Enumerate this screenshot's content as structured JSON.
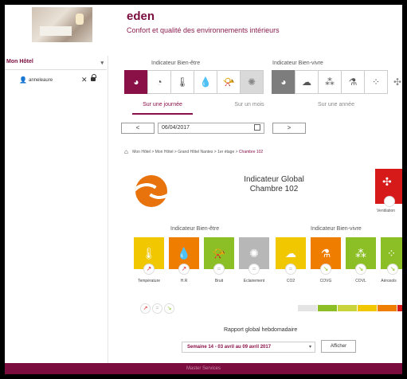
{
  "header": {
    "brand": "eden",
    "tagline": "Confort et qualité des environnements intérieurs"
  },
  "sidebar": {
    "hotel_select": "Mon Hôtel",
    "user": "anneleaure"
  },
  "indicators": {
    "wellbeing_title": "Indicateur Bien-être",
    "livability_title": "Indicateur Bien-vivre"
  },
  "tabs": [
    "Sur une journée",
    "Sur un mois",
    "Sur une année"
  ],
  "date_nav": {
    "prev": "<",
    "date": "06/04/2017",
    "next": ">"
  },
  "breadcrumb": {
    "path": "Mon Hôtel > Mon Hôtel > Grand Hôtel Nantes > 1er étage > ",
    "current": "Chambre 102"
  },
  "global": {
    "title_line1": "Indicateur Global",
    "title_line2": "Chambre 102",
    "ventilation_label": "Ventilation"
  },
  "tiles_wellbeing": [
    "Température",
    "H.R",
    "Bruit",
    "Eclairement"
  ],
  "tiles_livability": [
    "CO2",
    "COVG",
    "COVL",
    "Aérosols"
  ],
  "colors": {
    "brand": "#7a0c3e",
    "yellow": "#f1c700",
    "orange": "#ef7d00",
    "green": "#8cbf26",
    "gray": "#b7b7b7",
    "red": "#d61a1a"
  },
  "report": {
    "label": "Rapport global hebdomadaire",
    "week": "Semaine 14 - 03 avril au 09 avril 2017",
    "button": "Afficher"
  },
  "footer": {
    "label": "Master Services"
  }
}
